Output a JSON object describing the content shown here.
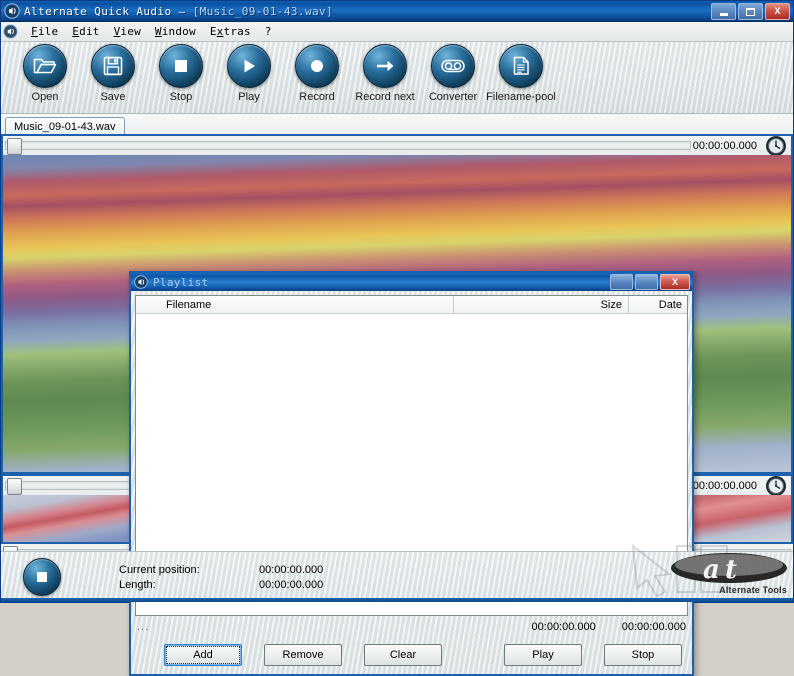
{
  "window": {
    "title_app": "Alternate Quick Audio",
    "title_sep": "—",
    "title_file": "[Music_09-01-43.wav]",
    "icon": "speaker-icon",
    "controls": {
      "minimize": "minimize-button",
      "maximize": "maximize-button",
      "close_label": "X"
    }
  },
  "menu": {
    "icon": "speaker-icon",
    "items": [
      {
        "pre": "",
        "mnemonic": "F",
        "post": "ile"
      },
      {
        "pre": "",
        "mnemonic": "E",
        "post": "dit"
      },
      {
        "pre": "",
        "mnemonic": "V",
        "post": "iew"
      },
      {
        "pre": "",
        "mnemonic": "W",
        "post": "indow"
      },
      {
        "pre": "E",
        "mnemonic": "x",
        "post": "tras"
      },
      {
        "pre": "?",
        "mnemonic": "",
        "post": ""
      }
    ]
  },
  "toolbar": {
    "buttons": [
      {
        "label": "Open",
        "icon": "folder-open-icon"
      },
      {
        "label": "Save",
        "icon": "floppy-disk-icon"
      },
      {
        "label": "Stop",
        "icon": "stop-square-icon"
      },
      {
        "label": "Play",
        "icon": "play-triangle-icon"
      },
      {
        "label": "Record",
        "icon": "record-circle-icon"
      },
      {
        "label": "Record next",
        "icon": "arrow-right-circle-icon"
      },
      {
        "label": "Converter",
        "icon": "cassette-icon"
      },
      {
        "label": "Filename-pool",
        "icon": "document-lines-icon"
      }
    ]
  },
  "tabs": [
    {
      "label": "Music_09-01-43.wav",
      "active": true
    }
  ],
  "document": {
    "channels": [
      {
        "name": "channel-top",
        "time": "00:00:00.000",
        "clock_icon": "clock-icon"
      },
      {
        "name": "channel-bottom",
        "time": "00:00:00.000",
        "clock_icon": "clock-icon"
      }
    ]
  },
  "status": {
    "stop_icon": "stop-square-icon",
    "position_label": "Current position:",
    "position_value": "00:00:00.000",
    "length_label": "Length:",
    "length_value": "00:00:00.000",
    "brand": "Alternate Tools"
  },
  "playlist": {
    "title": "Playlist",
    "icon": "speaker-icon",
    "controls": {
      "minimize": "minimize-button",
      "maximize": "maximize-button",
      "close_label": "X"
    },
    "columns": [
      {
        "label": "Filename"
      },
      {
        "label": "Size"
      },
      {
        "label": "Date"
      }
    ],
    "rows": [],
    "info": {
      "dots": "...",
      "time_total": "00:00:00.000",
      "time_selected": "00:00:00.000"
    },
    "buttons": [
      {
        "label": "Add",
        "focused": true
      },
      {
        "label": "Remove",
        "focused": false
      },
      {
        "label": "Clear",
        "focused": false
      },
      {
        "label": "Play",
        "focused": false
      },
      {
        "label": "Stop",
        "focused": false
      }
    ]
  },
  "colors": {
    "titlebar_blue": "#0a4f9f",
    "accent_blue": "#1d61ad",
    "close_red": "#a52f27",
    "toolbar_orb": "#2a6f9e"
  }
}
